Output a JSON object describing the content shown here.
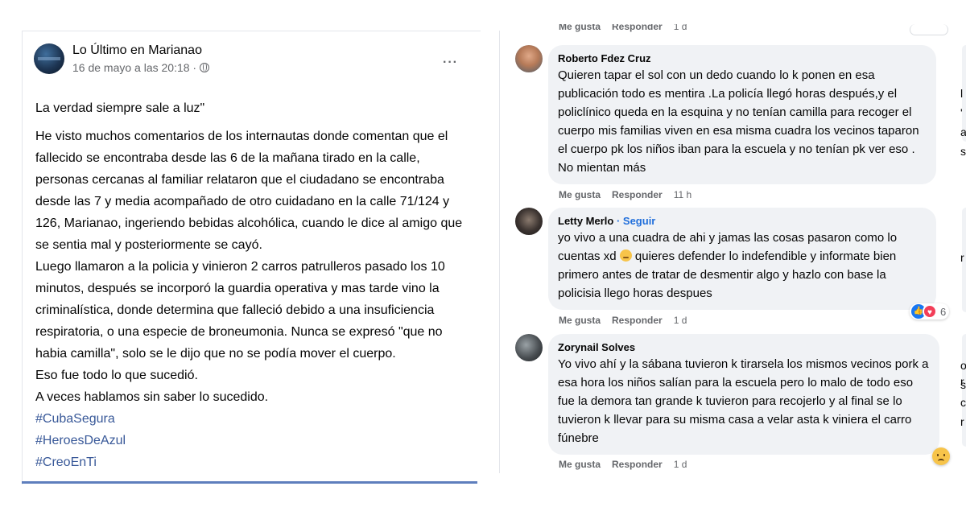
{
  "post": {
    "page_name": "Lo Último en Marianao",
    "timestamp": "16 de mayo a las 20:18 ·",
    "more_label": "···",
    "quote": "La verdad siempre sale a luz\"",
    "paragraph1": "He visto muchos comentarios de los internautas donde comentan que el fallecido se encontraba desde las 6 de la mañana tirado en la calle, personas cercanas al familiar relataron que el ciudadano se encontraba desde las 7 y media acompañado de otro cuidadano  en la calle 71/124 y 126, Marianao, ingeriendo bebidas alcohólica, cuando le dice al amigo que se sentia mal y posteriormente se cayó.",
    "paragraph2": "Luego llamaron a la policia y vinieron 2 carros patrulleros pasado los  10 minutos, después se incorporó la guardia operativa y mas tarde vino la criminalística, donde determina que falleció debido a una insuficiencia respiratoria, o una especie de  broneumonia. Nunca se expresó \"que no habia camilla\", solo se le dijo que no se podía mover el cuerpo.",
    "line3": "Eso fue todo lo que sucedió.",
    "line4": "A veces hablamos sin saber lo sucedido.",
    "hashtags": [
      "#CubaSegura",
      "#HeroesDeAzul",
      "#CreoEnTi"
    ]
  },
  "top_actions": {
    "like": "Me gusta",
    "reply": "Responder",
    "time": "1 d"
  },
  "comments": [
    {
      "author": "Roberto Fdez Cruz",
      "text": "Quieren tapar el sol con un dedo cuando lo k ponen en esa publicación todo es mentira .La policía llegó horas después,y el policlínico queda en la esquina y no tenían camilla para recoger el cuerpo mis familias viven en esa misma cuadra los vecinos taparon el cuerpo pk los niños iban para la escuela y no tenían pk ver eso . No mientan más",
      "like": "Me gusta",
      "reply": "Responder",
      "time": "11 h"
    },
    {
      "author": "Letty Merlo",
      "follow": "· Seguir",
      "text_before_emoji": "yo vivo a una cuadra de ahi y jamas las cosas pasaron como lo cuentas xd",
      "text_after_emoji": " quieres defender lo indefendible y informate bien primero antes de tratar de desmentir algo y hazlo con base la policisia llego horas despues",
      "like": "Me gusta",
      "reply": "Responder",
      "time": "1 d",
      "reaction_count": "6"
    },
    {
      "author": "Zorynail Solves",
      "text": "Yo vivo ahí y la sábana tuvieron k tirarsela los mismos vecinos pork a esa hora los niños salían para la escuela pero lo malo de todo eso fue la demora tan grande k tuvieron para recojerlo y al final se lo tuvieron k llevar para su misma casa a velar asta k viniera el carro fúnebre",
      "like": "Me gusta",
      "reply": "Responder",
      "time": "1 d"
    }
  ],
  "edge_chars": [
    "l",
    "'",
    "a",
    "s",
    "r",
    "r",
    "o",
    "s",
    "c",
    "r"
  ]
}
